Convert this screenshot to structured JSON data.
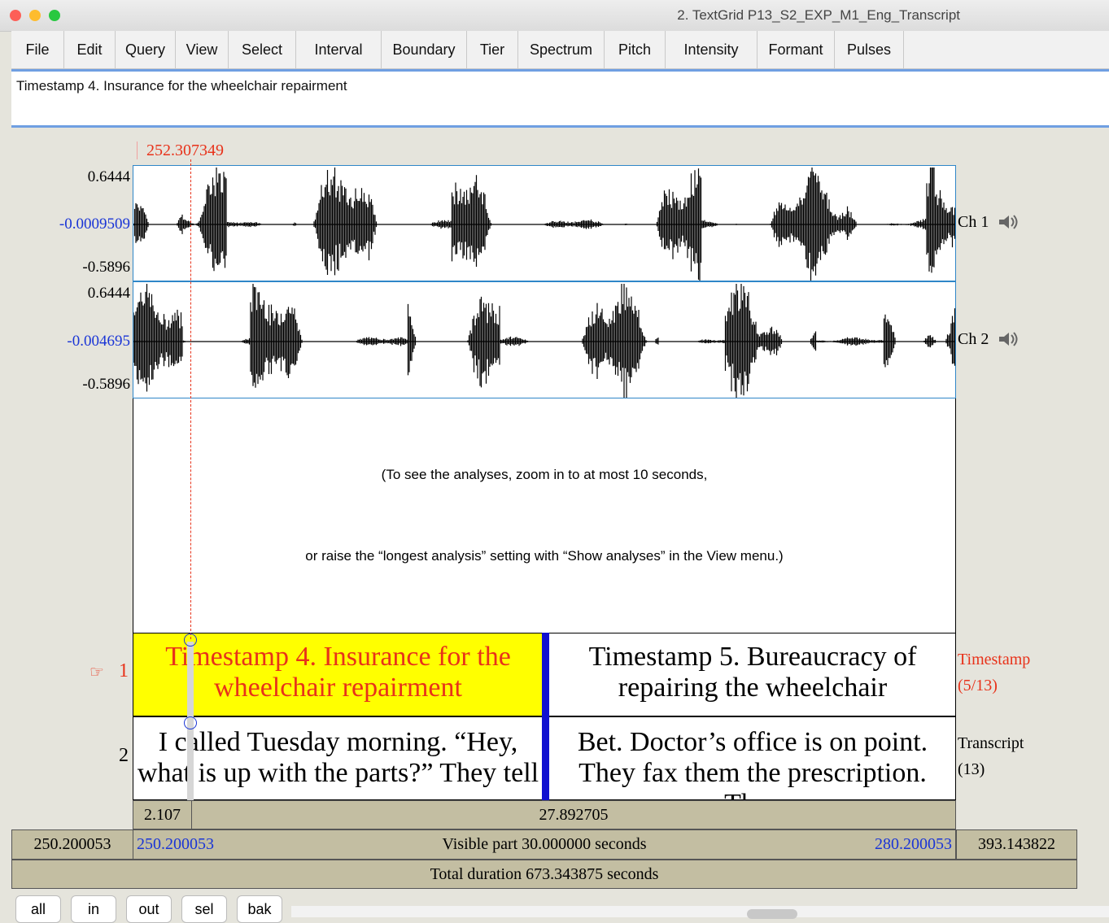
{
  "window": {
    "title": "2. TextGrid P13_S2_EXP_M1_Eng_Transcript"
  },
  "menu": [
    "File",
    "Edit",
    "Query",
    "View",
    "Select",
    "Interval",
    "Boundary",
    "Tier",
    "Spectrum",
    "Pitch",
    "Intensity",
    "Formant",
    "Pulses"
  ],
  "text_field": {
    "value": "Timestamp 4. Insurance for the wheelchair repairment"
  },
  "cursor": {
    "time_label": "252.307349"
  },
  "channels": [
    {
      "max": "0.6444",
      "mid": "-0.0009509",
      "min": "-0.5896",
      "label": "Ch 1"
    },
    {
      "max": "0.6444",
      "mid": "-0.004695",
      "min": "-0.5896",
      "label": "Ch 2"
    }
  ],
  "analysis_message": {
    "line1": "(To see the analyses, zoom in to at most 10 seconds,",
    "line2": "or raise the “longest analysis” setting with “Show analyses” in the View menu.)"
  },
  "tiers": [
    {
      "number": "1",
      "pointer": "☞",
      "name": "Timestamp",
      "count": "(5/13)",
      "left_text": "Timestamp 4. Insurance for the wheelchair repairment",
      "right_text": "Timestamp 5. Bureaucracy of repairing the wheelchair"
    },
    {
      "number": "2",
      "name": "Transcript",
      "count": "(13)",
      "left_text": "I called Tuesday morning. “Hey, what is up with the parts?” They tell",
      "right_text": "Bet. Doctor’s office is on point. They fax them the prescription. They"
    }
  ],
  "time_bars": {
    "selection_left": "2.107",
    "selection_right": "27.892705",
    "left_outer": "250.200053",
    "visible_start": "250.200053",
    "visible_label": "Visible part 30.000000 seconds",
    "visible_end": "280.200053",
    "right_outer": "393.143822",
    "total_label": "Total duration 673.343875 seconds"
  },
  "buttons": [
    "all",
    "in",
    "out",
    "sel",
    "bak"
  ],
  "colors": {
    "accent_red": "#e8321a",
    "label_blue": "#1a35d6",
    "selected_interval": "#ffff00",
    "boundary_blue": "#1010d0",
    "bar_tan": "#c3bea2"
  }
}
